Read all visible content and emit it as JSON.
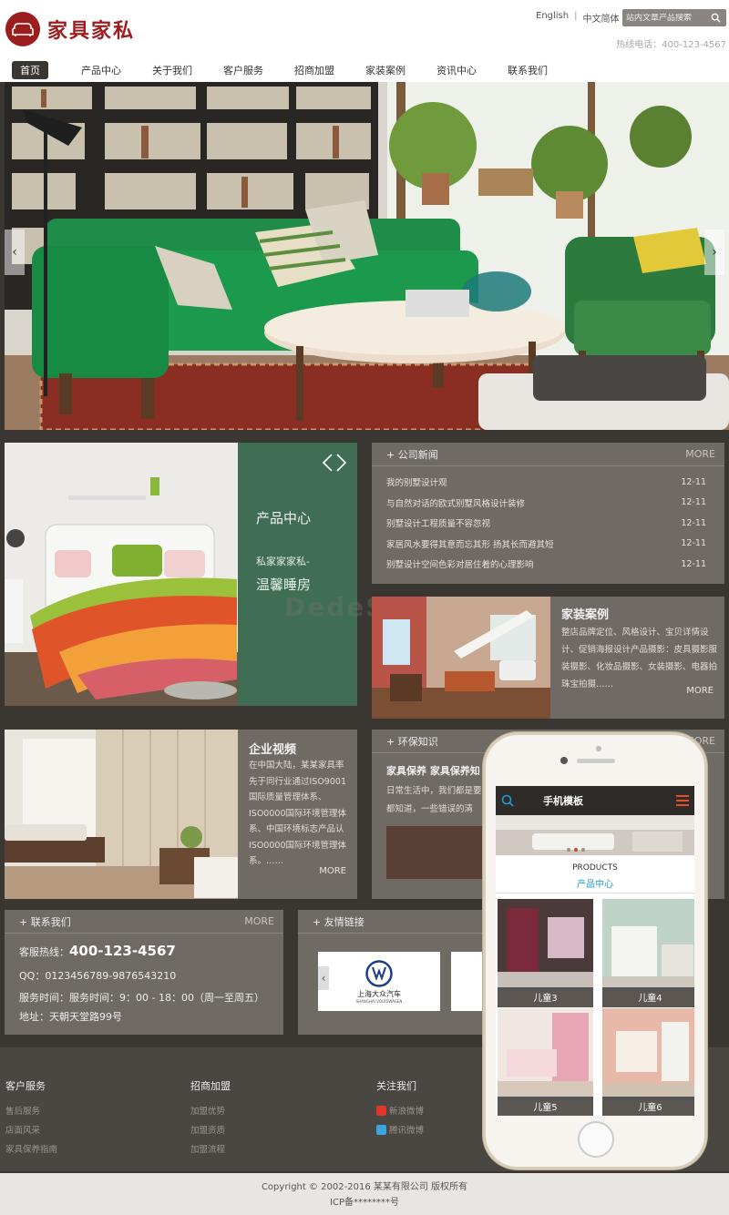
{
  "header": {
    "logo_text": "家具家私",
    "lang_en": "English",
    "lang_cn": "中文简体",
    "search_placeholder": "站内文章产品搜索",
    "hotline": "热线电话：400-123-4567"
  },
  "nav": [
    "首页",
    "产品中心",
    "关于我们",
    "客户服务",
    "招商加盟",
    "家装案例",
    "资讯中心",
    "联系我们"
  ],
  "product_center": {
    "title": "产品中心",
    "line1": "私家家家私-",
    "line2": "温馨睡房"
  },
  "news": {
    "title": "+ 公司新闻",
    "more": "MORE",
    "items": [
      {
        "text": "我的别墅设计观",
        "date": "12-11"
      },
      {
        "text": "与自然对话的欧式别墅风格设计装修",
        "date": "12-11"
      },
      {
        "text": "别墅设计工程质量不容忽视",
        "date": "12-11"
      },
      {
        "text": "家居风水要得其意而忘其形 扬其长而避其短",
        "date": "12-11"
      },
      {
        "text": "别墅设计空间色彩对居住着的心理影响",
        "date": "12-11"
      }
    ]
  },
  "watermark": "DedeS...com",
  "cases": {
    "title": "家装案例",
    "body": "整店品牌定位、风格设计、宝贝详情设计、促销海报设计产品摄影：皮具摄影服装摄影、化妆品摄影、女装摄影、电器拍珠宝拍摄……",
    "more": "MORE"
  },
  "video": {
    "title": "企业视频",
    "body": "在中国大陆，某某家具率先于同行业通过ISO9001国际质量管理体系、ISO0000国际环境管理体系、中国环境标志产品认ISO0000国际环境管理体系。……",
    "more": "MORE"
  },
  "eco": {
    "title": "+ 环保知识",
    "more": "MORE",
    "subtitle": "家具保养 家具保养知",
    "body": "日常生活中，我们都是要家都知道，一些错误的清"
  },
  "contact": {
    "title": "+ 联系我们",
    "more": "MORE",
    "hotline_label": "客服热线：",
    "hotline": "400-123-4567",
    "qq": "QQ：0123456789-9876543210",
    "hours": "服务时间：服务时间：9：00 - 18：00（周一至周五）",
    "address": "地址：天朝天堂路99号"
  },
  "links": {
    "title": "+ 友情链接",
    "vw_cn": "上海大众汽车",
    "vw_en": "SHANGHAI VOLKSWAGEN"
  },
  "footer": {
    "col1": {
      "title": "客户服务",
      "items": [
        "售后服务",
        "店面风采",
        "家具保养指南"
      ]
    },
    "col2": {
      "title": "招商加盟",
      "items": [
        "加盟优势",
        "加盟资质",
        "加盟流程"
      ]
    },
    "col3": {
      "title": "关注我们",
      "items": [
        "新浪微博",
        "腾讯微博"
      ]
    }
  },
  "copyright": "Copyright © 2002-2016 某某有限公司 版权所有",
  "icp": "ICP备********号",
  "phone": {
    "header_title": "手机模板",
    "products_en": "PRODUCTS",
    "products_cn": "产品中心",
    "items": [
      "儿童3",
      "儿童4",
      "儿童5",
      "儿童6"
    ]
  },
  "colors": {
    "brand": "#9b1d1d",
    "dark_bg": "#3a3632",
    "panel": "#706a64",
    "green": "#3f6e55",
    "accent_blue": "#1aa0d8"
  }
}
